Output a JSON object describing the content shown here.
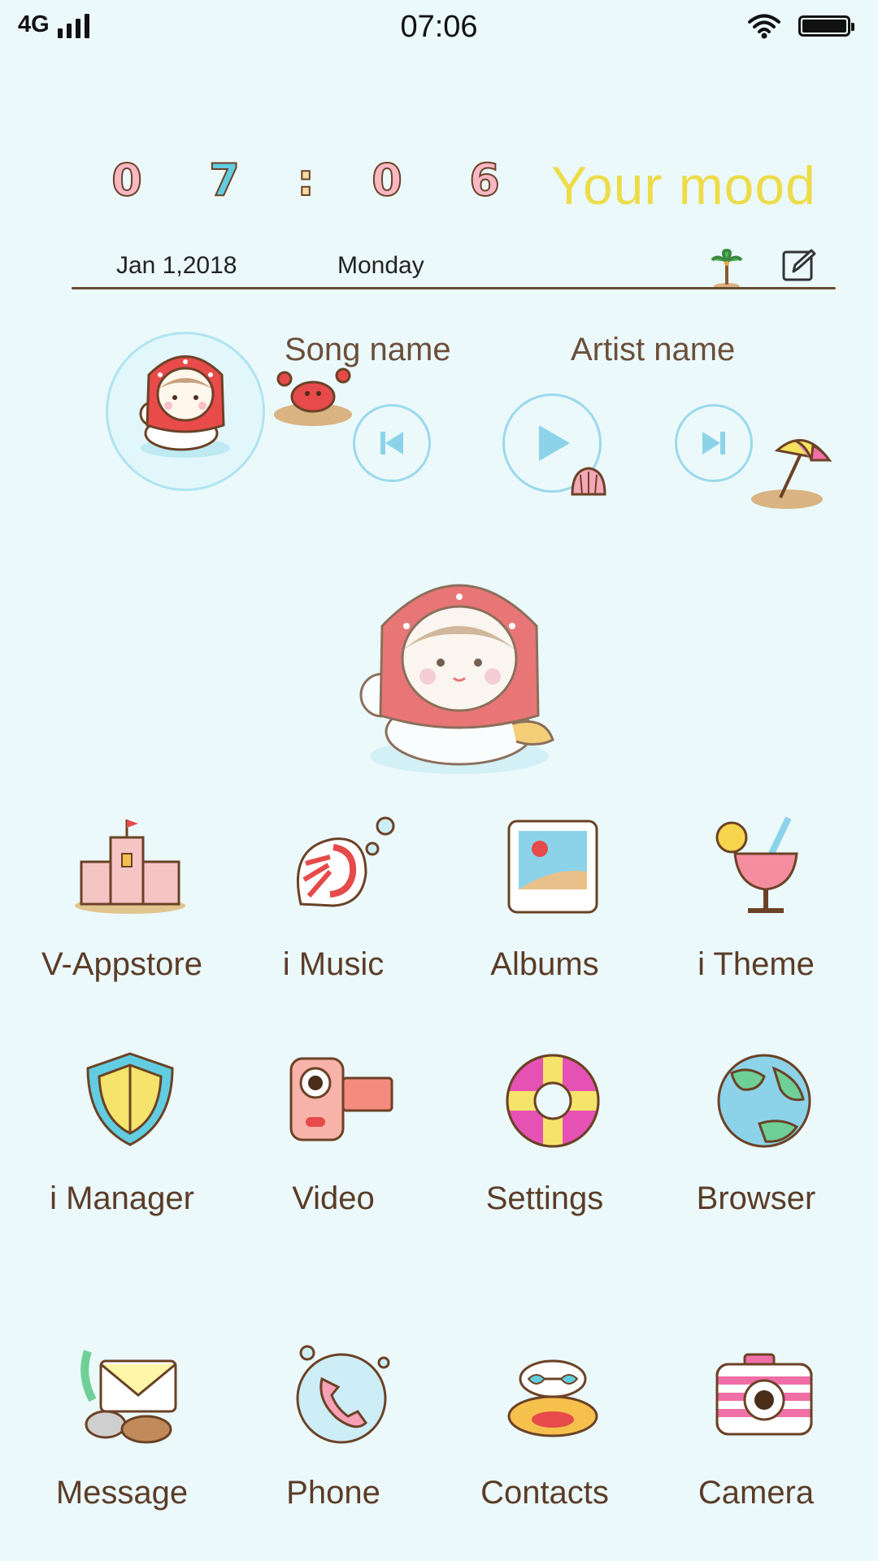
{
  "status_bar": {
    "network": "4G",
    "time": "07:06"
  },
  "clock_widget": {
    "digits": [
      "0",
      "7",
      ":",
      "0",
      "6"
    ],
    "mood": "Your mood",
    "date": "Jan 1,2018",
    "day": "Monday"
  },
  "music_widget": {
    "song_name": "Song name",
    "artist_name": "Artist name"
  },
  "apps": [
    {
      "label": "V-Appstore",
      "icon": "sandcastle-icon"
    },
    {
      "label": "i Music",
      "icon": "seashell-icon"
    },
    {
      "label": "Albums",
      "icon": "photo-frame-icon"
    },
    {
      "label": "i Theme",
      "icon": "cocktail-icon"
    },
    {
      "label": "i Manager",
      "icon": "shield-icon"
    },
    {
      "label": "Video",
      "icon": "video-camera-icon"
    },
    {
      "label": "Settings",
      "icon": "lifebuoy-icon"
    },
    {
      "label": "Browser",
      "icon": "globe-icon"
    },
    {
      "label": "Message",
      "icon": "envelope-icon"
    },
    {
      "label": "Phone",
      "icon": "phone-bubble-icon"
    },
    {
      "label": "Contacts",
      "icon": "sunglasses-float-icon"
    },
    {
      "label": "Camera",
      "icon": "camera-icon"
    }
  ],
  "colors": {
    "background": "#ebf9fb",
    "mood_text": "#eddc4a",
    "label_text": "#5b3c27",
    "control_ring": "#9ad9ec"
  }
}
